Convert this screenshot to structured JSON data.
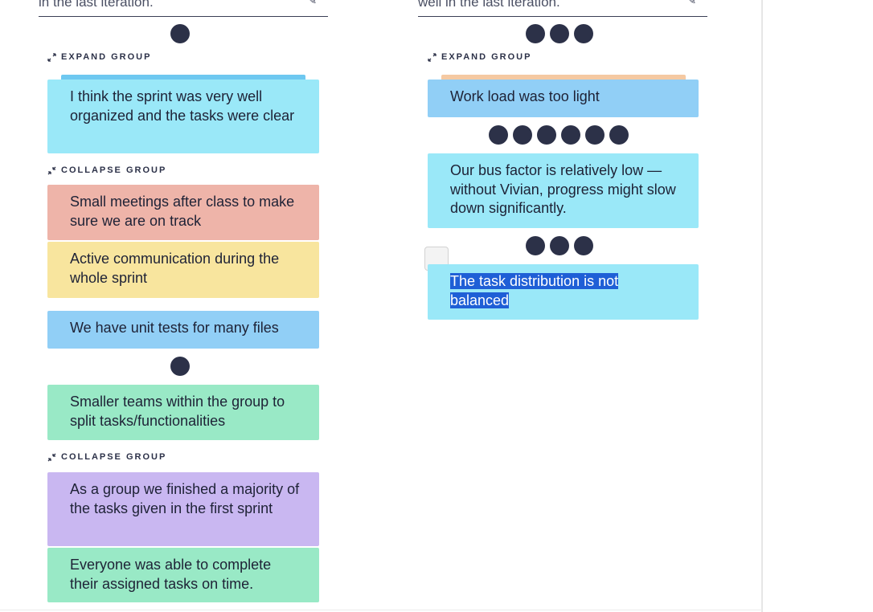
{
  "columns": [
    {
      "header_text": "in the last iteration.",
      "top_votes": 1,
      "expand_label": "EXPAND GROUP",
      "cards": [
        {
          "text": "I think the sprint was very well organized and the tasks were clear",
          "color": "#9ae8f8"
        },
        {
          "text": "Small meetings after class to make sure we are on track",
          "color": "#eeb4a9"
        },
        {
          "text": "Active communication during the whole sprint",
          "color": "#f8e59e"
        },
        {
          "text": "We have unit tests for many files",
          "color": "#91cff6"
        },
        {
          "text": "Smaller teams within the group to split tasks/functionalities",
          "color": "#99e9c6"
        },
        {
          "text": "As a group we finished a majority of the tasks given in the first sprint",
          "color": "#c9b7f1"
        },
        {
          "text": "Everyone was able to complete their assigned tasks on time.",
          "color": "#99e9c6"
        }
      ],
      "collapse_labels": [
        "COLLAPSE GROUP",
        "COLLAPSE GROUP"
      ],
      "mid_votes": 1
    },
    {
      "header_text": "well in the last iteration.",
      "top_votes": 3,
      "expand_label": "EXPAND GROUP",
      "cards": [
        {
          "text": "Work load was too light",
          "color": "#91cff6"
        },
        {
          "text": "Our bus factor is relatively low — without Vivian, progress might slow down significantly.",
          "color": "#9ae8f8"
        },
        {
          "text_line1": "The task distribution is not",
          "text_line2": "balanced",
          "color": "#9ae8f8",
          "selected": true
        }
      ],
      "vote_counts": [
        6,
        3
      ]
    }
  ],
  "colors": {
    "selection": "#1f5fd6",
    "dot": "#2c3148",
    "stack_tab_left": "#6ec8f0",
    "stack_tab_right": "#f5c9a2"
  },
  "icons": [
    "edit-icon",
    "expand-icon",
    "collapse-icon"
  ]
}
